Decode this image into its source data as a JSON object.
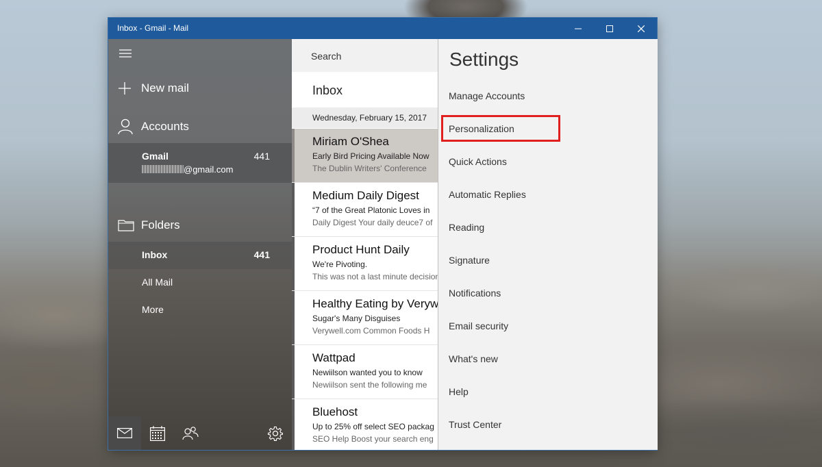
{
  "window": {
    "title": "Inbox - Gmail - Mail",
    "accent": "#1e5a9c"
  },
  "nav": {
    "new_mail": "New mail",
    "accounts_label": "Accounts",
    "account": {
      "name": "Gmail",
      "email_suffix": "@gmail.com",
      "count": "441"
    },
    "folders_label": "Folders",
    "folders": [
      {
        "label": "Inbox",
        "count": "441"
      },
      {
        "label": "All Mail",
        "count": ""
      },
      {
        "label": "More",
        "count": ""
      }
    ],
    "bottom_icons": [
      "mail-icon",
      "calendar-icon",
      "people-icon",
      "gear-icon"
    ]
  },
  "list": {
    "search_placeholder": "Search",
    "title": "Inbox",
    "date_header": "Wednesday, February 15, 2017",
    "messages": [
      {
        "sender": "Miriam O'Shea",
        "subject": "Early Bird Pricing Available Now",
        "preview": "The Dublin Writers' Conference"
      },
      {
        "sender": "Medium Daily Digest",
        "subject": "“7 of the Great Platonic Loves in",
        "preview": "Daily Digest Your daily deuce7 of"
      },
      {
        "sender": "Product Hunt Daily",
        "subject": "We're Pivoting.",
        "preview": "This was not a last minute decision"
      },
      {
        "sender": "Healthy Eating by Verywell",
        "subject": "Sugar's Many Disguises",
        "preview": "Verywell.com Common Foods H"
      },
      {
        "sender": "Wattpad",
        "subject": "Newiilson wanted you to know",
        "preview": "Newiilson sent the following me"
      },
      {
        "sender": "Bluehost",
        "subject": "Up to 25% off select SEO packag",
        "preview": "SEO Help Boost your search eng"
      }
    ]
  },
  "settings": {
    "heading": "Settings",
    "items": [
      "Manage Accounts",
      "Personalization",
      "Quick Actions",
      "Automatic Replies",
      "Reading",
      "Signature",
      "Notifications",
      "Email security",
      "What's new",
      "Help",
      "Trust Center"
    ],
    "highlight_color": "#e0201f"
  }
}
